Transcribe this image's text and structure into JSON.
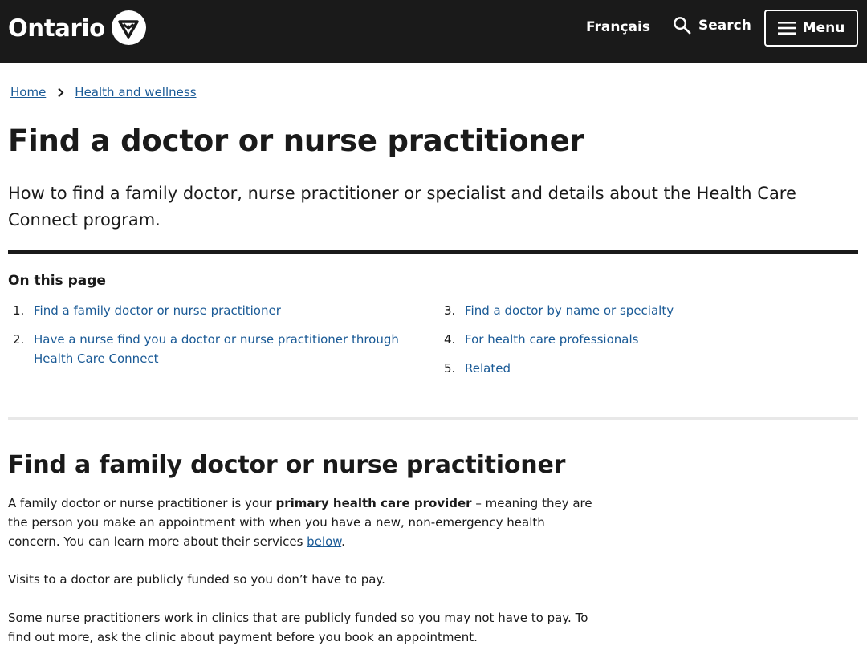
{
  "header": {
    "logo_text": "Ontario",
    "logo_icon": "trillium-icon",
    "language_label": "Français",
    "search_label": "Search",
    "menu_label": "Menu"
  },
  "breadcrumb": {
    "items": [
      "Home",
      "Health and wellness"
    ]
  },
  "page": {
    "title": "Find a doctor or nurse practitioner",
    "lead": "How to find a family doctor, nurse practitioner or specialist and details about the Health Care Connect program."
  },
  "toc": {
    "title": "On this page",
    "items": [
      {
        "num": "1.",
        "label": "Find a family doctor or nurse practitioner"
      },
      {
        "num": "2.",
        "label": "Have a nurse find you a doctor or nurse practitioner through Health Care Connect"
      },
      {
        "num": "3.",
        "label": "Find a doctor by name or specialty"
      },
      {
        "num": "4.",
        "label": "For health care professionals"
      },
      {
        "num": "5.",
        "label": "Related"
      }
    ]
  },
  "section": {
    "heading": "Find a family doctor or nurse practitioner",
    "p1_before": "A family doctor or nurse practitioner is your ",
    "p1_bold": "primary health care provider",
    "p1_after": " – meaning they are the person you make an appointment with when you have a new, non-emergency health concern. You can learn more about their services ",
    "p1_link": "below",
    "p1_end": ".",
    "p2": "Visits to a doctor are publicly funded so you don’t have to pay.",
    "p3": "Some nurse practitioners work in clinics that are publicly funded so you may not have to pay. To find out more, ask the clinic about payment before you book an appointment."
  },
  "colors": {
    "header_bg": "#1a1a1a",
    "link": "#1a5a96",
    "text": "#1a1a1a"
  }
}
